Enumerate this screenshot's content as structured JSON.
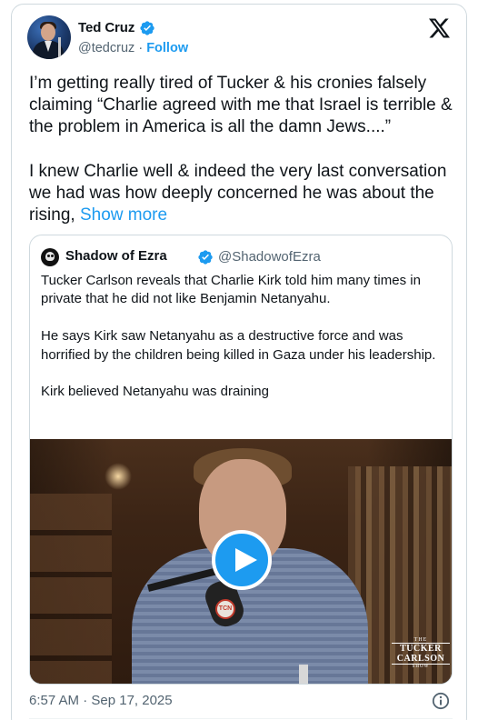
{
  "tweet": {
    "author": {
      "name": "Ted Cruz",
      "handle": "@tedcruz",
      "separator": "·",
      "follow_label": "Follow",
      "verified": true
    },
    "paragraph1": "I’m getting really tired of Tucker & his cronies falsely claiming “Charlie agreed with me that Israel is terrible & the problem in America is all the damn Jews....”",
    "paragraph2": "I knew Charlie well & indeed the very last conversation we had was how deeply concerned he was about the rising,",
    "show_more_label": "Show more",
    "timestamp": "6:57 AM · Sep 17, 2025"
  },
  "quote": {
    "author": {
      "name": "Shadow of Ezra",
      "handle": "@ShadowofEzra",
      "verified": true
    },
    "paragraphs": [
      "Tucker Carlson reveals that Charlie Kirk told him many times in private that he did not like Benjamin Netanyahu.",
      "He says Kirk saw Netanyahu as a destructive force and was horrified by the children being killed in Gaza under his leadership.",
      "Kirk believed Netanyahu was draining"
    ],
    "video": {
      "badge_the": "THE",
      "badge_line1": "TUCKER",
      "badge_line2": "CARLSON",
      "badge_show": "SHOW",
      "mic_flag": "TCN"
    }
  },
  "colors": {
    "accent": "#1d9bf0",
    "text": "#0f1419",
    "secondary": "#536471",
    "border": "#cfd9de"
  },
  "icons": {
    "verified": "verified-badge-icon",
    "platform": "x-logo-icon",
    "play": "play-icon",
    "info": "info-icon"
  }
}
